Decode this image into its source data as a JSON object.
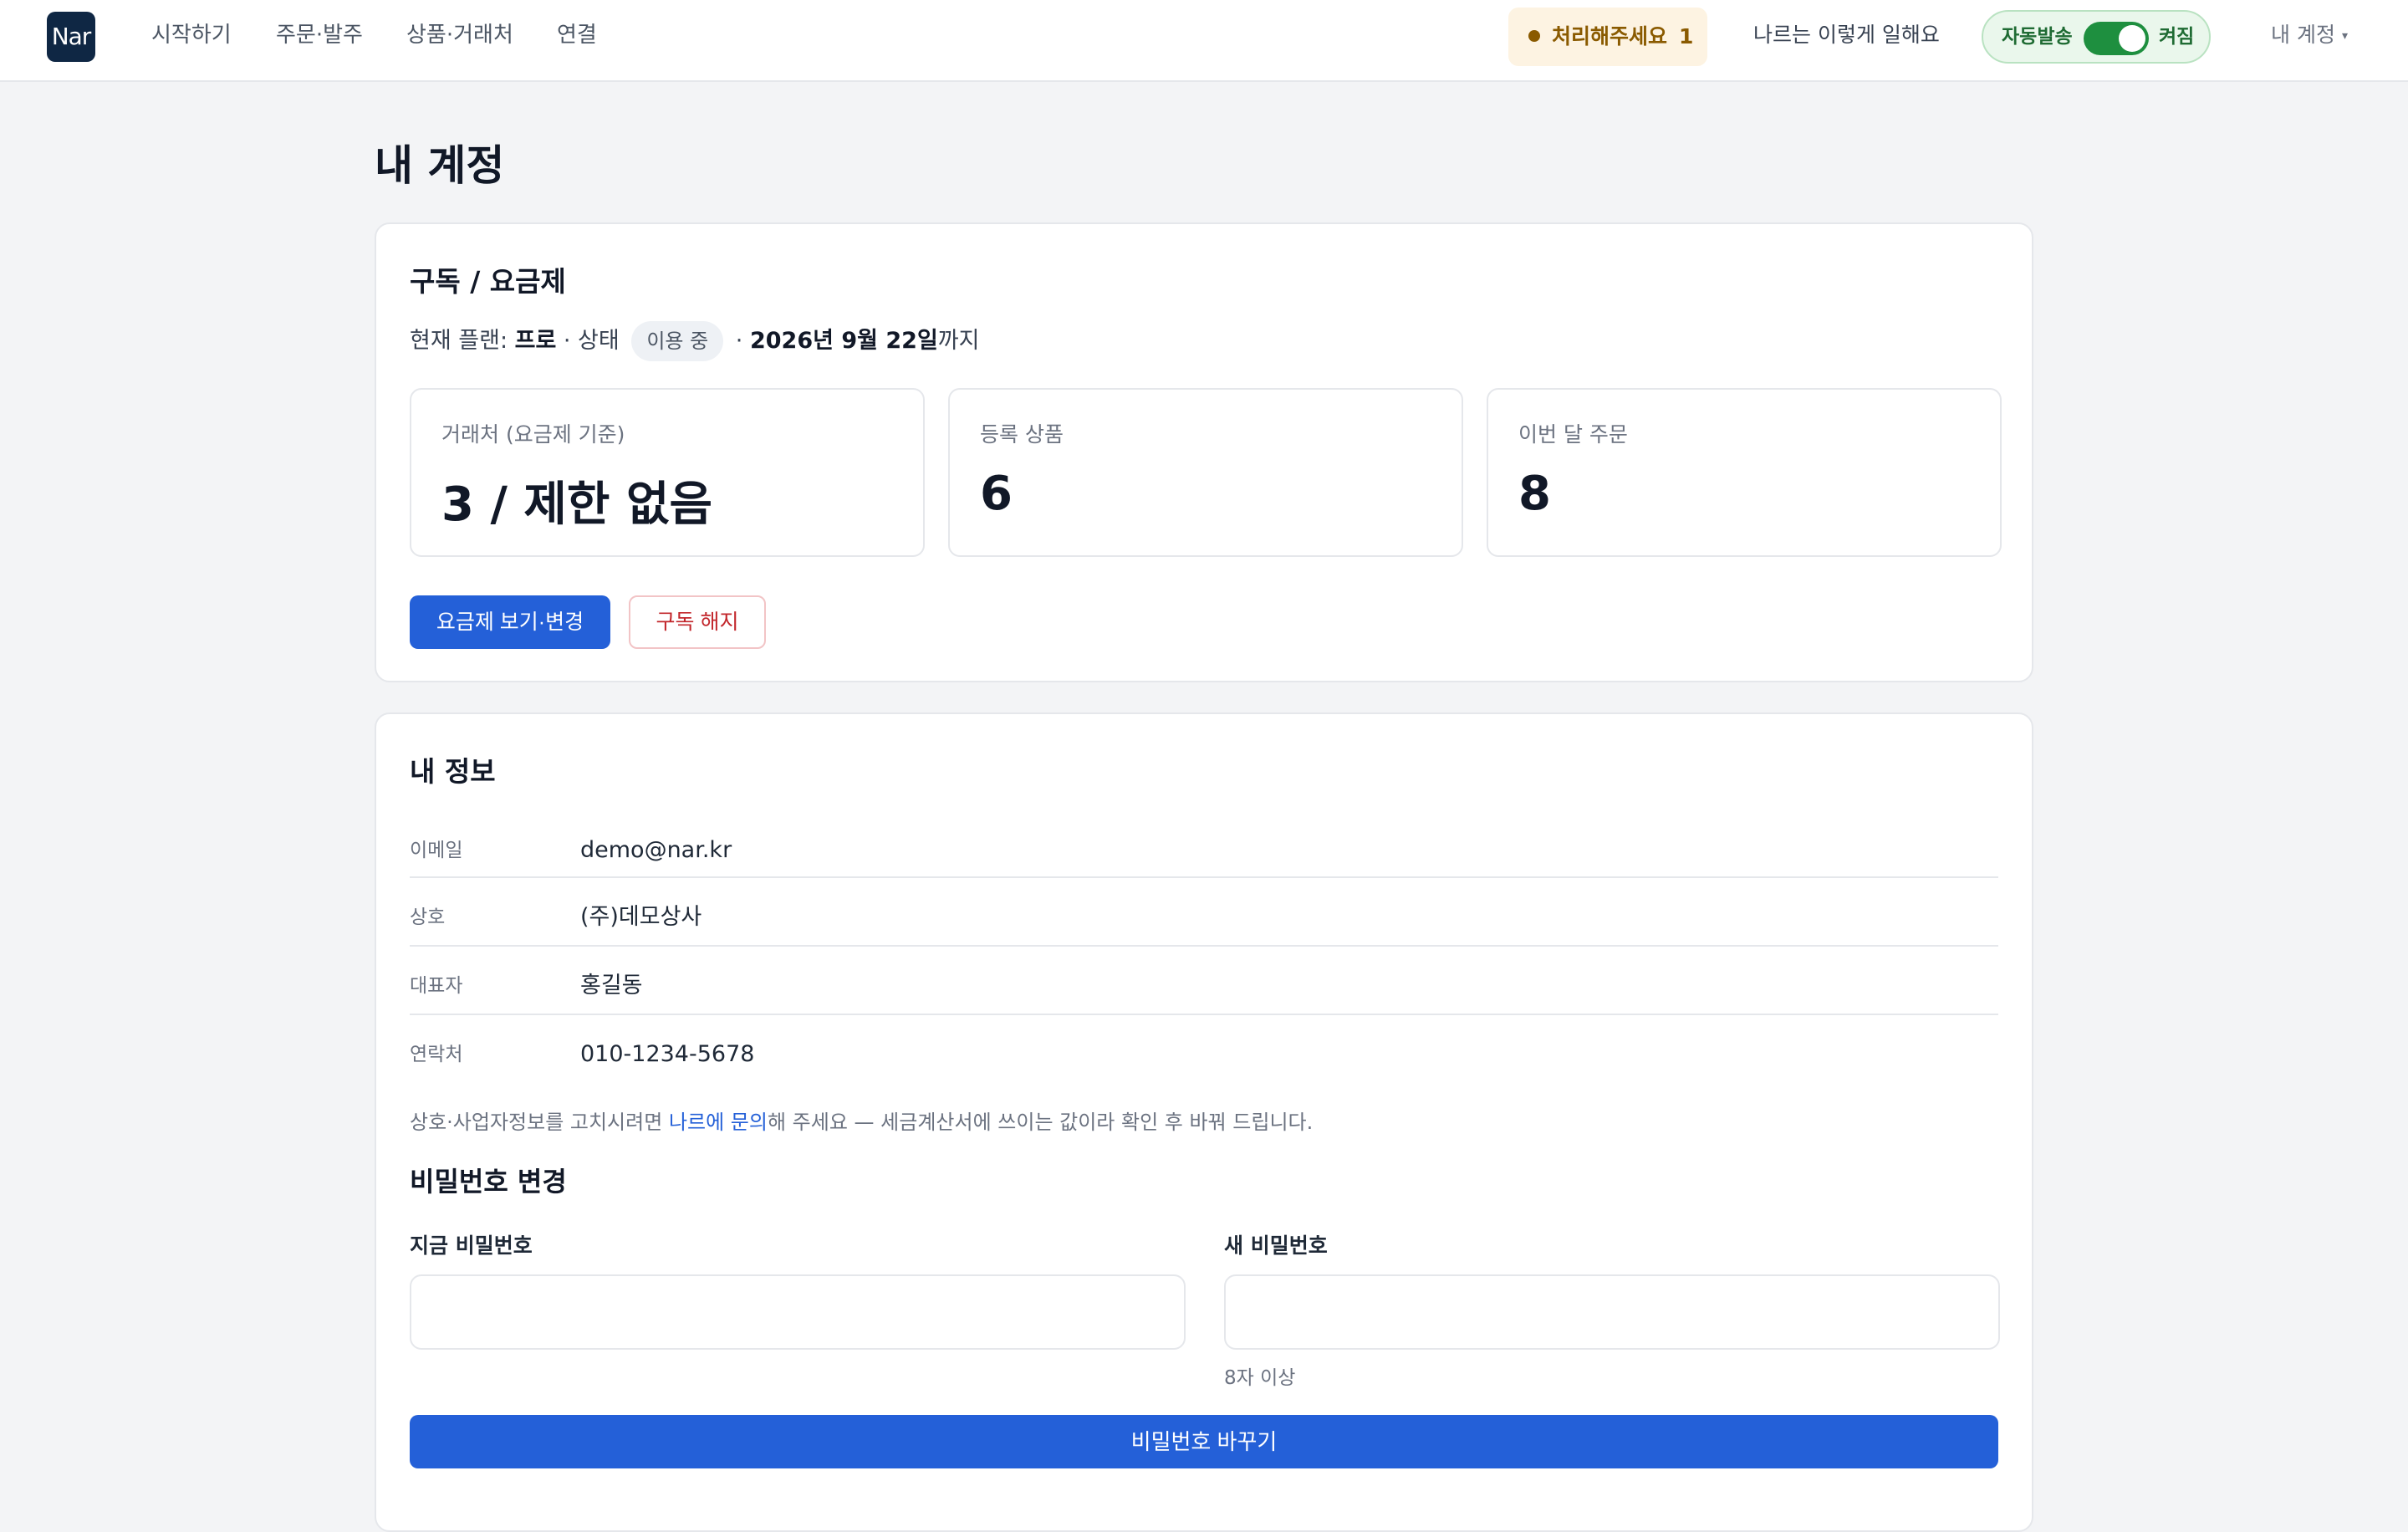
{
  "nav": {
    "logo": "Nar",
    "items": [
      "시작하기",
      "주문·발주",
      "상품·거래처",
      "연결"
    ],
    "alert_label": "처리해주세요",
    "alert_count": "1",
    "how_it_works": "나르는 이렇게 일해요",
    "auto_send_label": "자동발송",
    "auto_send_state": "켜짐",
    "account_menu": "내 계정",
    "account_caret": "▾"
  },
  "colors": {
    "accent": "#2460d8",
    "logo_bg": "#0f2744",
    "toggle_on": "#1e8f3f",
    "warn": "#8a5a00",
    "danger": "#c2262b"
  },
  "page_title": "내 계정",
  "subscription": {
    "title": "구독 / 요금제",
    "plan_prefix": "현재 플랜: ",
    "plan_name": "프로",
    "status_prefix": " · 상태 ",
    "status": "이용 중",
    "until_sep": " · ",
    "until_date": "2026년 9월 22일",
    "until_suffix": "까지",
    "stats": [
      {
        "label": "거래처 (요금제 기준)",
        "value": "3 / 제한 없음"
      },
      {
        "label": "등록 상품",
        "value": "6"
      },
      {
        "label": "이번 달 주문",
        "value": "8"
      }
    ],
    "view_change_button": "요금제 보기·변경",
    "cancel_button": "구독 해지"
  },
  "profile": {
    "title": "내 정보",
    "rows": [
      {
        "label": "이메일",
        "value": "demo@nar.kr"
      },
      {
        "label": "상호",
        "value": "(주)데모상사"
      },
      {
        "label": "대표자",
        "value": "홍길동"
      },
      {
        "label": "연락처",
        "value": "010-1234-5678"
      }
    ],
    "note_prefix": "상호·사업자정보를 고치시려면 ",
    "note_link": "나르에 문의",
    "note_suffix": "해 주세요 — 세금계산서에 쓰이는 값이라 확인 후 바꿔 드립니다."
  },
  "password": {
    "title": "비밀번호 변경",
    "current_label": "지금 비밀번호",
    "current_value": "",
    "new_label": "새 비밀번호",
    "new_value": "",
    "new_hint": "8자 이상",
    "submit_button": "비밀번호 바꾸기"
  }
}
